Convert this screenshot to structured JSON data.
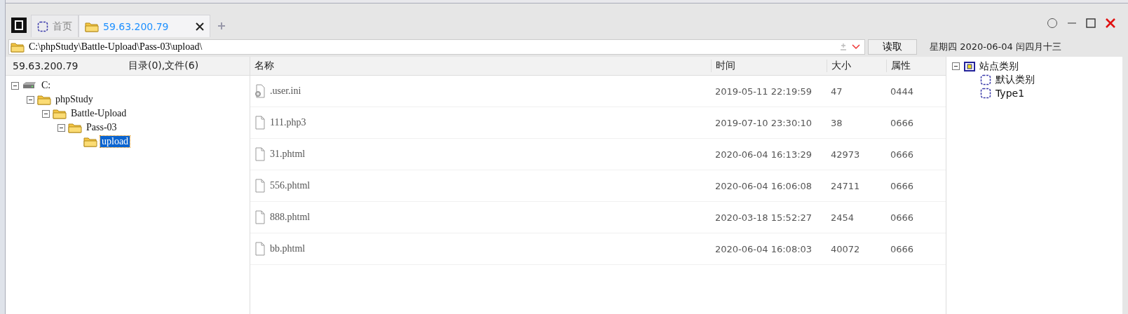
{
  "tabs": [
    {
      "label": "首页",
      "kind": "home",
      "selected": false
    },
    {
      "label": "59.63.200.79",
      "kind": "folder",
      "selected": true
    }
  ],
  "address": {
    "value": "C:\\phpStudy\\Battle-Upload\\Pass-03\\upload\\"
  },
  "read_button": "读取",
  "date": "星期四 2020-06-04 闰四月十三",
  "left_header": {
    "host": "59.63.200.79",
    "summary": "目录(0),文件(6)"
  },
  "tree": [
    {
      "label": "C:",
      "kind": "drive",
      "expanded": true,
      "selected": false,
      "children": [
        {
          "label": "phpStudy",
          "kind": "folder",
          "expanded": true,
          "selected": false,
          "children": [
            {
              "label": "Battle-Upload",
              "kind": "folder",
              "expanded": true,
              "selected": false,
              "children": [
                {
                  "label": "Pass-03",
                  "kind": "folder",
                  "expanded": true,
                  "selected": false,
                  "children": [
                    {
                      "label": "upload",
                      "kind": "folder",
                      "selected": true
                    }
                  ]
                }
              ]
            }
          ]
        }
      ]
    }
  ],
  "files": {
    "columns": [
      "名称",
      "时间",
      "大小",
      "属性"
    ],
    "rows": [
      {
        "kind": "config",
        "name": ".user.ini",
        "time": "2019-05-11 22:19:59",
        "size": "47",
        "attr": "0444"
      },
      {
        "kind": "file",
        "name": "111.php3",
        "time": "2019-07-10 23:30:10",
        "size": "38",
        "attr": "0666"
      },
      {
        "kind": "file",
        "name": "31.phtml",
        "time": "2020-06-04 16:13:29",
        "size": "42973",
        "attr": "0666"
      },
      {
        "kind": "file",
        "name": "556.phtml",
        "time": "2020-06-04 16:06:08",
        "size": "24711",
        "attr": "0666"
      },
      {
        "kind": "file",
        "name": "888.phtml",
        "time": "2020-03-18 15:52:27",
        "size": "2454",
        "attr": "0666"
      },
      {
        "kind": "file",
        "name": "bb.phtml",
        "time": "2020-06-04 16:08:03",
        "size": "40072",
        "attr": "0666"
      }
    ]
  },
  "categories": [
    {
      "label": "站点类别",
      "expanded": true,
      "children": [
        {
          "label": "默认类别"
        },
        {
          "label": "Type1"
        }
      ]
    }
  ]
}
